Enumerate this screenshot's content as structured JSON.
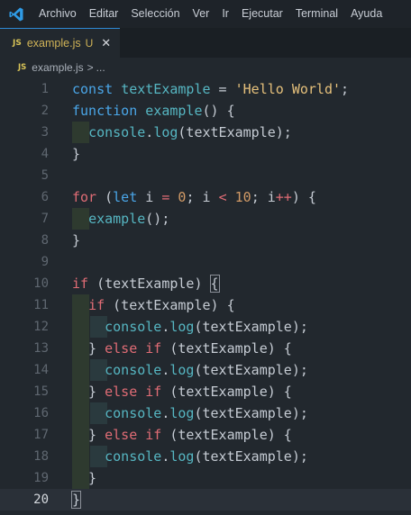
{
  "menu": [
    "Archivo",
    "Editar",
    "Selección",
    "Ver",
    "Ir",
    "Ejecutar",
    "Terminal",
    "Ayuda"
  ],
  "tab": {
    "badge": "JS",
    "name": "example.js",
    "status": "U",
    "close": "✕"
  },
  "breadcrumb": {
    "badge": "JS",
    "file": "example.js",
    "sep": ">",
    "rest": "..."
  },
  "lines": [
    {
      "n": "1",
      "g": 0,
      "tokens": [
        [
          "kw",
          "const "
        ],
        [
          "fn",
          "textExample"
        ],
        [
          "ident",
          " = "
        ],
        [
          "str",
          "'Hello World'"
        ],
        [
          "ident",
          ";"
        ]
      ]
    },
    {
      "n": "2",
      "g": 0,
      "tokens": [
        [
          "kw",
          "function "
        ],
        [
          "fn",
          "example"
        ],
        [
          "ident",
          "() {"
        ]
      ]
    },
    {
      "n": "3",
      "g": 1,
      "tokens": [
        [
          "ident",
          "  "
        ],
        [
          "fn",
          "console"
        ],
        [
          "ident",
          "."
        ],
        [
          "fn",
          "log"
        ],
        [
          "ident",
          "(textExample);"
        ]
      ]
    },
    {
      "n": "4",
      "g": 0,
      "tokens": [
        [
          "ident",
          "}"
        ]
      ]
    },
    {
      "n": "5",
      "g": 0,
      "tokens": []
    },
    {
      "n": "6",
      "g": 0,
      "tokens": [
        [
          "kw2",
          "for"
        ],
        [
          "ident",
          " ("
        ],
        [
          "kw",
          "let"
        ],
        [
          "ident",
          " i "
        ],
        [
          "kw2",
          "="
        ],
        [
          "ident",
          " "
        ],
        [
          "num",
          "0"
        ],
        [
          "ident",
          "; i "
        ],
        [
          "kw2",
          "<"
        ],
        [
          "ident",
          " "
        ],
        [
          "num",
          "10"
        ],
        [
          "ident",
          "; i"
        ],
        [
          "kw2",
          "++"
        ],
        [
          "ident",
          ") {"
        ]
      ]
    },
    {
      "n": "7",
      "g": 1,
      "tokens": [
        [
          "ident",
          "  "
        ],
        [
          "fn",
          "example"
        ],
        [
          "ident",
          "();"
        ]
      ]
    },
    {
      "n": "8",
      "g": 0,
      "tokens": [
        [
          "ident",
          "}"
        ]
      ]
    },
    {
      "n": "9",
      "g": 0,
      "tokens": []
    },
    {
      "n": "10",
      "g": 0,
      "tokens": [
        [
          "kw2",
          "if"
        ],
        [
          "ident",
          " (textExample) "
        ],
        [
          "brk",
          "{"
        ]
      ]
    },
    {
      "n": "11",
      "g": 1,
      "tokens": [
        [
          "ident",
          "  "
        ],
        [
          "kw2",
          "if"
        ],
        [
          "ident",
          " (textExample) {"
        ]
      ]
    },
    {
      "n": "12",
      "g": 2,
      "tokens": [
        [
          "ident",
          "    "
        ],
        [
          "fn",
          "console"
        ],
        [
          "ident",
          "."
        ],
        [
          "fn",
          "log"
        ],
        [
          "ident",
          "(textExample);"
        ]
      ]
    },
    {
      "n": "13",
      "g": 1,
      "tokens": [
        [
          "ident",
          "  } "
        ],
        [
          "kw2",
          "else if"
        ],
        [
          "ident",
          " (textExample) {"
        ]
      ]
    },
    {
      "n": "14",
      "g": 2,
      "tokens": [
        [
          "ident",
          "    "
        ],
        [
          "fn",
          "console"
        ],
        [
          "ident",
          "."
        ],
        [
          "fn",
          "log"
        ],
        [
          "ident",
          "(textExample);"
        ]
      ]
    },
    {
      "n": "15",
      "g": 1,
      "tokens": [
        [
          "ident",
          "  } "
        ],
        [
          "kw2",
          "else if"
        ],
        [
          "ident",
          " (textExample) {"
        ]
      ]
    },
    {
      "n": "16",
      "g": 2,
      "tokens": [
        [
          "ident",
          "    "
        ],
        [
          "fn",
          "console"
        ],
        [
          "ident",
          "."
        ],
        [
          "fn",
          "log"
        ],
        [
          "ident",
          "(textExample);"
        ]
      ]
    },
    {
      "n": "17",
      "g": 1,
      "tokens": [
        [
          "ident",
          "  } "
        ],
        [
          "kw2",
          "else if"
        ],
        [
          "ident",
          " (textExample) {"
        ]
      ]
    },
    {
      "n": "18",
      "g": 2,
      "tokens": [
        [
          "ident",
          "    "
        ],
        [
          "fn",
          "console"
        ],
        [
          "ident",
          "."
        ],
        [
          "fn",
          "log"
        ],
        [
          "ident",
          "(textExample);"
        ]
      ]
    },
    {
      "n": "19",
      "g": 1,
      "tokens": [
        [
          "ident",
          "  }"
        ]
      ]
    },
    {
      "n": "20",
      "g": 0,
      "current": true,
      "tokens": [
        [
          "brk",
          "}"
        ]
      ]
    }
  ],
  "colors": {
    "accent": "#2d8ad6",
    "keyword_blue": "#4aa6e8",
    "keyword_red": "#e06c75",
    "function": "#56b6c2",
    "string": "#e5c07b",
    "number": "#d19a66"
  }
}
